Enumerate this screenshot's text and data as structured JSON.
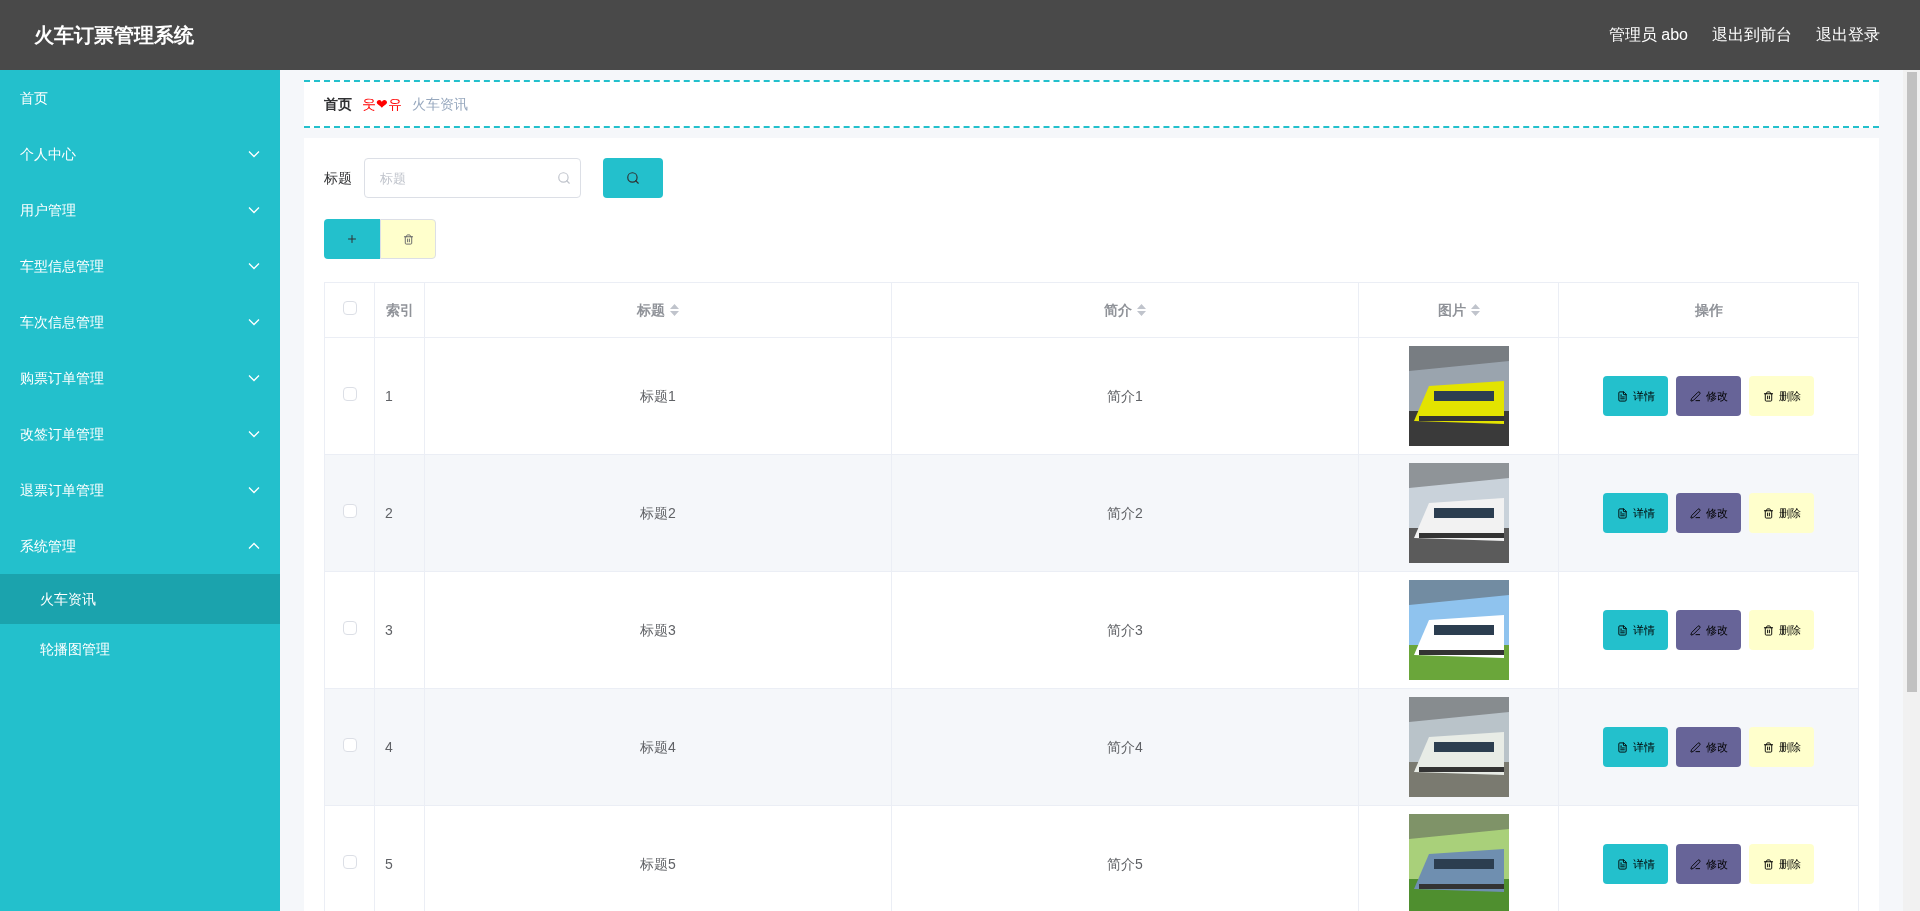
{
  "header": {
    "title": "火车订票管理系统",
    "links": [
      "管理员 abo",
      "退出到前台",
      "退出登录"
    ]
  },
  "sidebar": {
    "items": [
      {
        "label": "首页",
        "kind": "link"
      },
      {
        "label": "个人中心",
        "kind": "group",
        "expanded": false
      },
      {
        "label": "用户管理",
        "kind": "group",
        "expanded": false
      },
      {
        "label": "车型信息管理",
        "kind": "group",
        "expanded": false
      },
      {
        "label": "车次信息管理",
        "kind": "group",
        "expanded": false
      },
      {
        "label": "购票订单管理",
        "kind": "group",
        "expanded": false
      },
      {
        "label": "改签订单管理",
        "kind": "group",
        "expanded": false
      },
      {
        "label": "退票订单管理",
        "kind": "group",
        "expanded": false
      },
      {
        "label": "系统管理",
        "kind": "group",
        "expanded": true,
        "children": [
          {
            "label": "火车资讯",
            "selected": true
          },
          {
            "label": "轮播图管理",
            "selected": false
          }
        ]
      }
    ]
  },
  "breadcrumb": {
    "home": "首页",
    "separator": "웃❤유",
    "current": "火车资讯"
  },
  "search": {
    "label": "标题",
    "placeholder": "标题"
  },
  "table": {
    "select_all_checked": false,
    "columns": [
      {
        "label": "索引",
        "sortable": false
      },
      {
        "label": "标题",
        "sortable": true
      },
      {
        "label": "简介",
        "sortable": true
      },
      {
        "label": "图片",
        "sortable": true
      },
      {
        "label": "操作",
        "sortable": false
      }
    ],
    "rows": [
      {
        "index": "1",
        "title": "标题1",
        "summary": "简介1",
        "checked": false,
        "actions": [
          "详情",
          "修改",
          "删除"
        ]
      },
      {
        "index": "2",
        "title": "标题2",
        "summary": "简介2",
        "checked": false,
        "actions": [
          "详情",
          "修改",
          "删除"
        ]
      },
      {
        "index": "3",
        "title": "标题3",
        "summary": "简介3",
        "checked": false,
        "actions": [
          "详情",
          "修改",
          "删除"
        ]
      },
      {
        "index": "4",
        "title": "标题4",
        "summary": "简介4",
        "checked": false,
        "actions": [
          "详情",
          "修改",
          "删除"
        ]
      },
      {
        "index": "5",
        "title": "标题5",
        "summary": "简介5",
        "checked": false,
        "actions": [
          "详情",
          "修改",
          "删除"
        ]
      }
    ]
  }
}
